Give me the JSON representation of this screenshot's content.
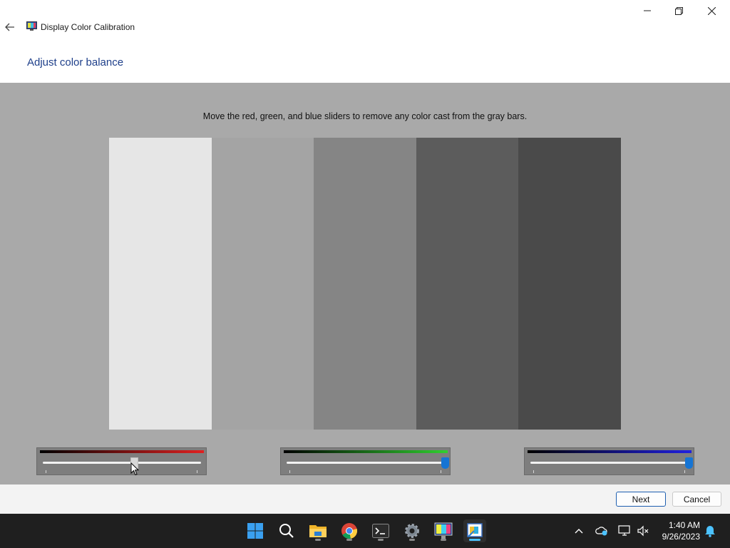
{
  "window": {
    "title": "Display Color Calibration",
    "app_icon": "monitor-calibration-icon",
    "controls": [
      "minimize-icon",
      "restore-icon",
      "close-icon"
    ]
  },
  "page": {
    "heading": "Adjust color balance",
    "instruction": "Move the red, green, and blue sliders to remove any color cast from the gray bars."
  },
  "gray_bars": [
    {
      "color": "#e6e6e6"
    },
    {
      "color": "#a4a4a4"
    },
    {
      "color": "#858585"
    },
    {
      "color": "#5c5c5c"
    },
    {
      "color": "#4a4a4a"
    }
  ],
  "sliders": [
    {
      "channel": "red",
      "gradient_end": "#e02020",
      "value_fraction": 0.58,
      "thumb_style": "gray"
    },
    {
      "channel": "green",
      "gradient_end": "#30d030",
      "value_fraction": 1.0,
      "thumb_style": "blue"
    },
    {
      "channel": "blue",
      "gradient_end": "#2020e0",
      "value_fraction": 1.0,
      "thumb_style": "blue"
    }
  ],
  "buttons": {
    "next": "Next",
    "cancel": "Cancel"
  },
  "taskbar": {
    "apps": [
      "windows-start-icon",
      "search-icon",
      "file-explorer-icon",
      "chrome-icon",
      "terminal-icon",
      "settings-icon",
      "display-calibration-icon",
      "color-management-icon"
    ],
    "tray": [
      "chevron-up-icon",
      "onedrive-icon",
      "network-icon",
      "volume-muted-icon"
    ],
    "time": "1:40 AM",
    "date": "9/26/2023",
    "notification_icon": "bell-icon"
  },
  "colors": {
    "accent": "#1574d4",
    "heading": "#1e3f8a",
    "content_bg": "#a9a9a9"
  }
}
